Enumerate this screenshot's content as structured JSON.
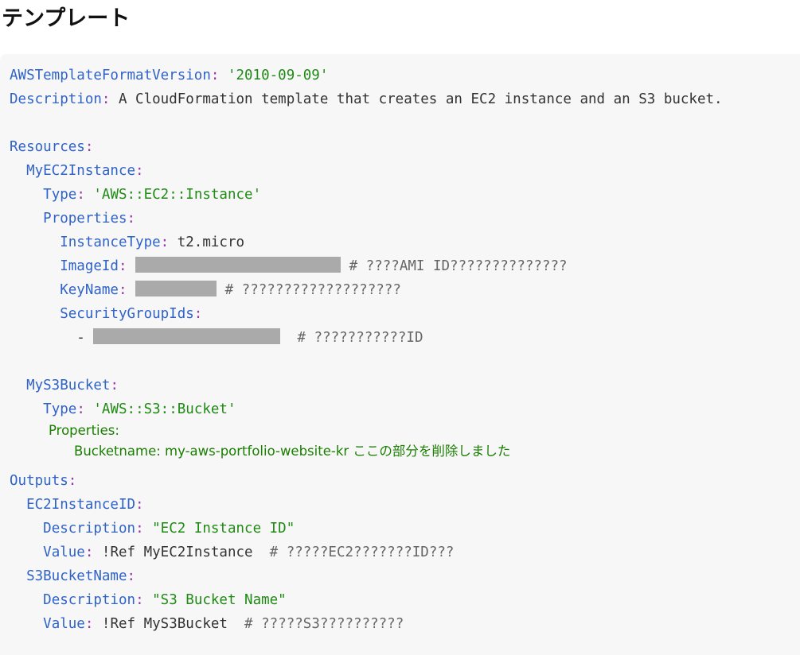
{
  "heading": "テンプレート",
  "code": {
    "l1_key": "AWSTemplateFormatVersion",
    "l1_val": "'2010-09-09'",
    "l2_key": "Description",
    "l2_val": "A CloudFormation template that creates an EC2 instance and an S3 bucket.",
    "l4_key": "Resources",
    "l5_key": "MyEC2Instance",
    "l6_key": "Type",
    "l6_val": "'AWS::EC2::Instance'",
    "l7_key": "Properties",
    "l8_key": "InstanceType",
    "l8_val": "t2.micro",
    "l9_key": "ImageId",
    "l9_comment": "# ????AMI ID??????????????",
    "l10_key": "KeyName",
    "l10_comment": "# ???????????????????",
    "l11_key": "SecurityGroupIds",
    "l12_dash": "-",
    "l12_comment": "# ???????????ID",
    "l14_key": "MyS3Bucket",
    "l15_key": "Type",
    "l15_val": "'AWS::S3::Bucket'",
    "l16_text": "Properties:",
    "l17_text": "Bucketname: my-aws-portfolio-website-kr",
    "l17_note": "ここの部分を削除しました",
    "l18_key": "Outputs",
    "l19_key": "EC2InstanceID",
    "l20_key": "Description",
    "l20_val": "\"EC2 Instance ID\"",
    "l21_key": "Value",
    "l21_val": "!Ref MyEC2Instance",
    "l21_comment": "# ?????EC2???????ID???",
    "l22_key": "S3BucketName",
    "l23_key": "Description",
    "l23_val": "\"S3 Bucket Name\"",
    "l24_key": "Value",
    "l24_val": "!Ref MyS3Bucket",
    "l24_comment": "# ?????S3??????????"
  }
}
